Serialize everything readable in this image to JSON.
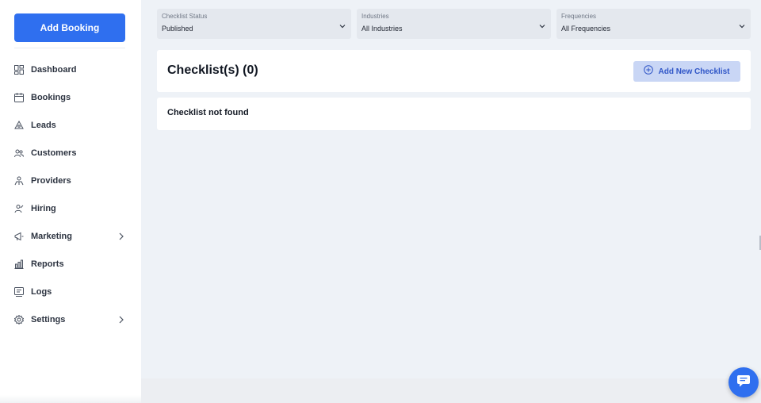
{
  "sidebar": {
    "add_booking_label": "Add Booking",
    "items": [
      {
        "label": "Dashboard",
        "icon": "dashboard-icon",
        "has_submenu": false
      },
      {
        "label": "Bookings",
        "icon": "calendar-icon",
        "has_submenu": false
      },
      {
        "label": "Leads",
        "icon": "leads-icon",
        "has_submenu": false
      },
      {
        "label": "Customers",
        "icon": "customers-icon",
        "has_submenu": false
      },
      {
        "label": "Providers",
        "icon": "providers-icon",
        "has_submenu": false
      },
      {
        "label": "Hiring",
        "icon": "hiring-icon",
        "has_submenu": false
      },
      {
        "label": "Marketing",
        "icon": "marketing-icon",
        "has_submenu": true
      },
      {
        "label": "Reports",
        "icon": "reports-icon",
        "has_submenu": false
      },
      {
        "label": "Logs",
        "icon": "logs-icon",
        "has_submenu": false
      },
      {
        "label": "Settings",
        "icon": "gear-icon",
        "has_submenu": true
      }
    ]
  },
  "filters": {
    "status": {
      "label": "Checklist Status",
      "value": "Published"
    },
    "industries": {
      "label": "Industries",
      "value": "All Industries"
    },
    "frequencies": {
      "label": "Frequencies",
      "value": "All Frequencies"
    }
  },
  "main": {
    "title": "Checklist(s) (0)",
    "add_button_label": "Add New Checklist",
    "empty_message": "Checklist not found"
  },
  "colors": {
    "accent": "#2f6fef",
    "button_soft_bg": "#c9d6f5",
    "button_soft_text": "#2f55c7"
  }
}
